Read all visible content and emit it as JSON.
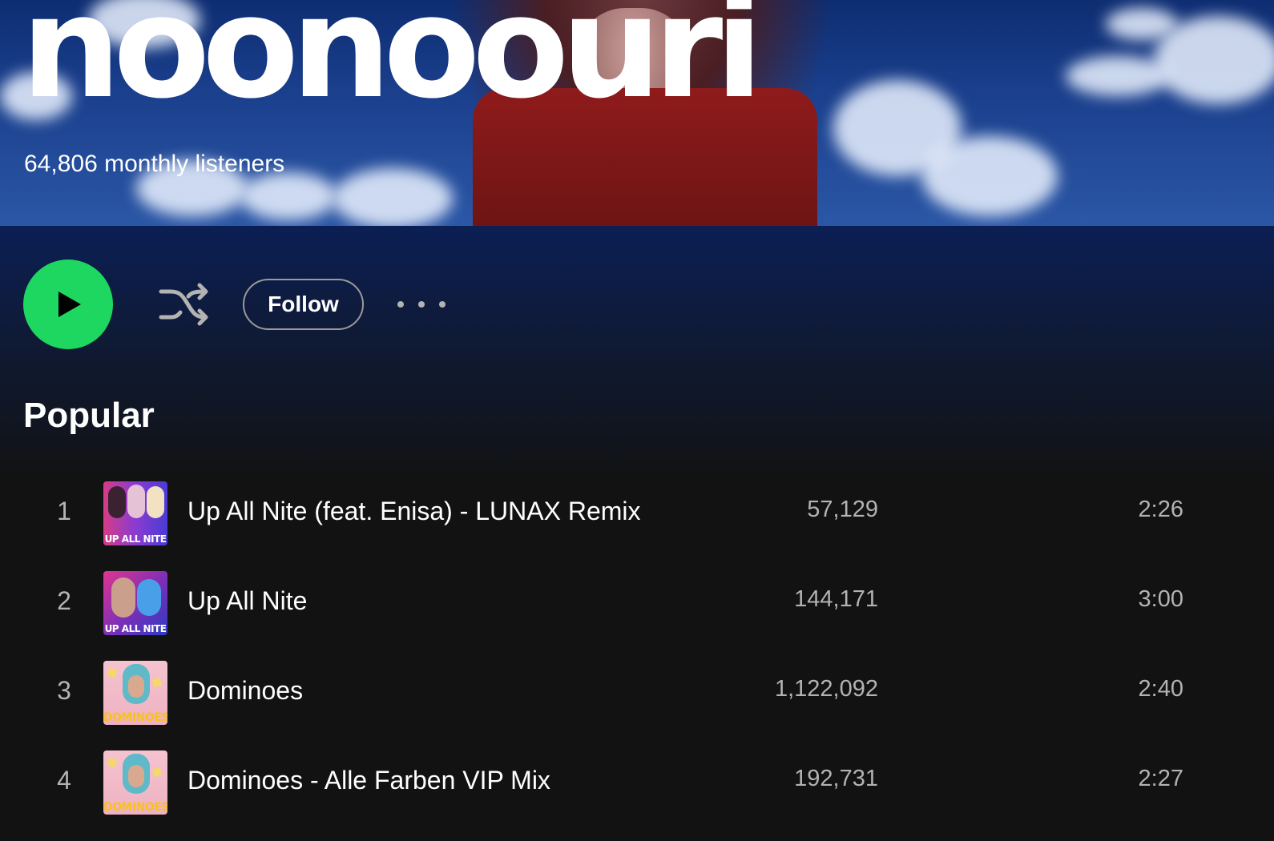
{
  "artist": {
    "name": "noonoouri",
    "monthly_listeners": "64,806 monthly listeners"
  },
  "actions": {
    "play_icon": "play-icon",
    "shuffle_icon": "shuffle-icon",
    "follow_label": "Follow",
    "more_icon": "more-options-icon"
  },
  "popular": {
    "title": "Popular",
    "tracks": [
      {
        "rank": "1",
        "title": "Up All Nite (feat. Enisa) - LUNAX Remix",
        "plays": "57,129",
        "duration": "2:26",
        "cover_text": "UP ALL NITE"
      },
      {
        "rank": "2",
        "title": "Up All Nite",
        "plays": "144,171",
        "duration": "3:00",
        "cover_text": "UP ALL NITE"
      },
      {
        "rank": "3",
        "title": "Dominoes",
        "plays": "1,122,092",
        "duration": "2:40",
        "cover_text": "DOMINOES"
      },
      {
        "rank": "4",
        "title": "Dominoes - Alle Farben VIP Mix",
        "plays": "192,731",
        "duration": "2:27",
        "cover_text": "DOMINOES"
      }
    ]
  },
  "colors": {
    "accent": "#1ed760",
    "background": "#121212",
    "hero_blue": "#1a3f8c",
    "secondary_text": "#b3b3b3"
  }
}
